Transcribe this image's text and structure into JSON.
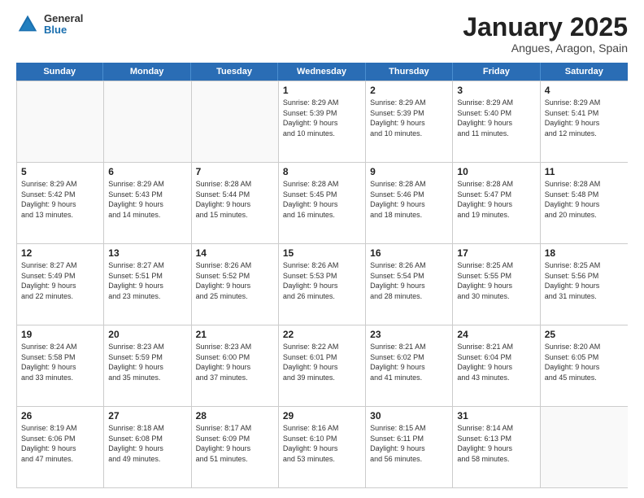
{
  "header": {
    "logo_general": "General",
    "logo_blue": "Blue",
    "title": "January 2025",
    "location": "Angues, Aragon, Spain"
  },
  "weekdays": [
    "Sunday",
    "Monday",
    "Tuesday",
    "Wednesday",
    "Thursday",
    "Friday",
    "Saturday"
  ],
  "weeks": [
    [
      {
        "day": "",
        "info": ""
      },
      {
        "day": "",
        "info": ""
      },
      {
        "day": "",
        "info": ""
      },
      {
        "day": "1",
        "info": "Sunrise: 8:29 AM\nSunset: 5:39 PM\nDaylight: 9 hours\nand 10 minutes."
      },
      {
        "day": "2",
        "info": "Sunrise: 8:29 AM\nSunset: 5:39 PM\nDaylight: 9 hours\nand 10 minutes."
      },
      {
        "day": "3",
        "info": "Sunrise: 8:29 AM\nSunset: 5:40 PM\nDaylight: 9 hours\nand 11 minutes."
      },
      {
        "day": "4",
        "info": "Sunrise: 8:29 AM\nSunset: 5:41 PM\nDaylight: 9 hours\nand 12 minutes."
      }
    ],
    [
      {
        "day": "5",
        "info": "Sunrise: 8:29 AM\nSunset: 5:42 PM\nDaylight: 9 hours\nand 13 minutes."
      },
      {
        "day": "6",
        "info": "Sunrise: 8:29 AM\nSunset: 5:43 PM\nDaylight: 9 hours\nand 14 minutes."
      },
      {
        "day": "7",
        "info": "Sunrise: 8:28 AM\nSunset: 5:44 PM\nDaylight: 9 hours\nand 15 minutes."
      },
      {
        "day": "8",
        "info": "Sunrise: 8:28 AM\nSunset: 5:45 PM\nDaylight: 9 hours\nand 16 minutes."
      },
      {
        "day": "9",
        "info": "Sunrise: 8:28 AM\nSunset: 5:46 PM\nDaylight: 9 hours\nand 18 minutes."
      },
      {
        "day": "10",
        "info": "Sunrise: 8:28 AM\nSunset: 5:47 PM\nDaylight: 9 hours\nand 19 minutes."
      },
      {
        "day": "11",
        "info": "Sunrise: 8:28 AM\nSunset: 5:48 PM\nDaylight: 9 hours\nand 20 minutes."
      }
    ],
    [
      {
        "day": "12",
        "info": "Sunrise: 8:27 AM\nSunset: 5:49 PM\nDaylight: 9 hours\nand 22 minutes."
      },
      {
        "day": "13",
        "info": "Sunrise: 8:27 AM\nSunset: 5:51 PM\nDaylight: 9 hours\nand 23 minutes."
      },
      {
        "day": "14",
        "info": "Sunrise: 8:26 AM\nSunset: 5:52 PM\nDaylight: 9 hours\nand 25 minutes."
      },
      {
        "day": "15",
        "info": "Sunrise: 8:26 AM\nSunset: 5:53 PM\nDaylight: 9 hours\nand 26 minutes."
      },
      {
        "day": "16",
        "info": "Sunrise: 8:26 AM\nSunset: 5:54 PM\nDaylight: 9 hours\nand 28 minutes."
      },
      {
        "day": "17",
        "info": "Sunrise: 8:25 AM\nSunset: 5:55 PM\nDaylight: 9 hours\nand 30 minutes."
      },
      {
        "day": "18",
        "info": "Sunrise: 8:25 AM\nSunset: 5:56 PM\nDaylight: 9 hours\nand 31 minutes."
      }
    ],
    [
      {
        "day": "19",
        "info": "Sunrise: 8:24 AM\nSunset: 5:58 PM\nDaylight: 9 hours\nand 33 minutes."
      },
      {
        "day": "20",
        "info": "Sunrise: 8:23 AM\nSunset: 5:59 PM\nDaylight: 9 hours\nand 35 minutes."
      },
      {
        "day": "21",
        "info": "Sunrise: 8:23 AM\nSunset: 6:00 PM\nDaylight: 9 hours\nand 37 minutes."
      },
      {
        "day": "22",
        "info": "Sunrise: 8:22 AM\nSunset: 6:01 PM\nDaylight: 9 hours\nand 39 minutes."
      },
      {
        "day": "23",
        "info": "Sunrise: 8:21 AM\nSunset: 6:02 PM\nDaylight: 9 hours\nand 41 minutes."
      },
      {
        "day": "24",
        "info": "Sunrise: 8:21 AM\nSunset: 6:04 PM\nDaylight: 9 hours\nand 43 minutes."
      },
      {
        "day": "25",
        "info": "Sunrise: 8:20 AM\nSunset: 6:05 PM\nDaylight: 9 hours\nand 45 minutes."
      }
    ],
    [
      {
        "day": "26",
        "info": "Sunrise: 8:19 AM\nSunset: 6:06 PM\nDaylight: 9 hours\nand 47 minutes."
      },
      {
        "day": "27",
        "info": "Sunrise: 8:18 AM\nSunset: 6:08 PM\nDaylight: 9 hours\nand 49 minutes."
      },
      {
        "day": "28",
        "info": "Sunrise: 8:17 AM\nSunset: 6:09 PM\nDaylight: 9 hours\nand 51 minutes."
      },
      {
        "day": "29",
        "info": "Sunrise: 8:16 AM\nSunset: 6:10 PM\nDaylight: 9 hours\nand 53 minutes."
      },
      {
        "day": "30",
        "info": "Sunrise: 8:15 AM\nSunset: 6:11 PM\nDaylight: 9 hours\nand 56 minutes."
      },
      {
        "day": "31",
        "info": "Sunrise: 8:14 AM\nSunset: 6:13 PM\nDaylight: 9 hours\nand 58 minutes."
      },
      {
        "day": "",
        "info": ""
      }
    ]
  ]
}
